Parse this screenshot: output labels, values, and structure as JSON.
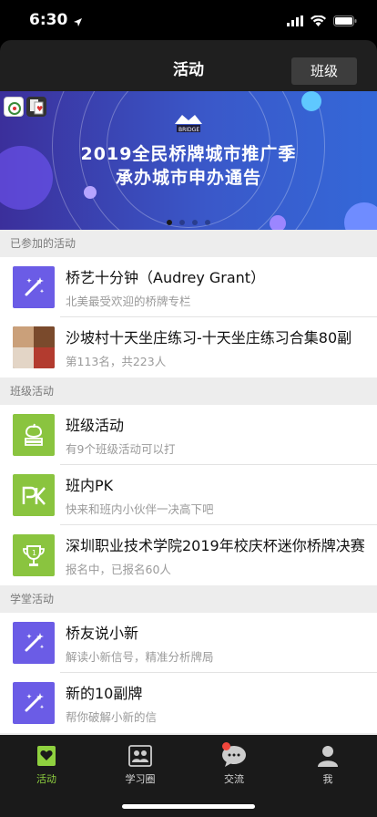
{
  "status": {
    "time": "6:30"
  },
  "nav": {
    "title": "活动",
    "right_button": "班级"
  },
  "banner": {
    "line1": "2019全民桥牌城市推广季",
    "line2": "承办城市申办通告"
  },
  "sections": [
    {
      "header": "已参加的活动",
      "items": [
        {
          "title": "桥艺十分钟（Audrey Grant）",
          "subtitle": "北美最受欢迎的桥牌专栏",
          "icon": "magic-wand-icon"
        },
        {
          "title": "沙坡村十天坐庄练习-十天坐庄练习合集80副",
          "subtitle": "第113名，共223人",
          "icon": "photo-thumbnail"
        }
      ]
    },
    {
      "header": "班级活动",
      "items": [
        {
          "title": "班级活动",
          "subtitle": "有9个班级活动可以打",
          "icon": "apple-books-icon"
        },
        {
          "title": "班内PK",
          "subtitle": "快来和班内小伙伴一决高下吧",
          "icon": "pk-icon"
        },
        {
          "title": "深圳职业技术学院2019年校庆杯迷你桥牌决赛",
          "subtitle": "报名中，已报名60人",
          "icon": "trophy-icon"
        }
      ]
    },
    {
      "header": "学堂活动",
      "items": [
        {
          "title": "桥友说小新",
          "subtitle": "解读小新信号，精准分析牌局",
          "icon": "magic-wand-icon"
        },
        {
          "title": "新的10副牌",
          "subtitle": "帮你破解小新的信",
          "icon": "magic-wand-icon"
        }
      ]
    }
  ],
  "tabs": [
    {
      "label": "活动",
      "icon": "heart-card-icon"
    },
    {
      "label": "学习圈",
      "icon": "people-icon"
    },
    {
      "label": "交流",
      "icon": "chat-bubble-icon"
    },
    {
      "label": "我",
      "icon": "person-icon"
    }
  ],
  "colors": {
    "purple": "#6b5ce6",
    "green": "#8ac43f",
    "tab_active": "#8fd13f",
    "notification": "#f0463c"
  }
}
